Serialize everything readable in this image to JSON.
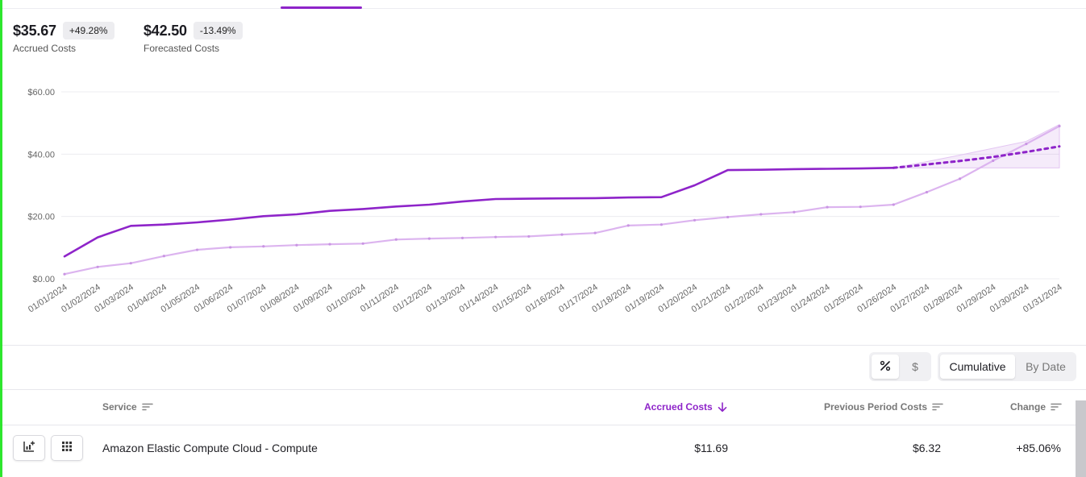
{
  "kpis": [
    {
      "value": "$35.67",
      "change": "+49.28%",
      "label": "Accrued Costs"
    },
    {
      "value": "$42.50",
      "change": "-13.49%",
      "label": "Forecasted Costs"
    }
  ],
  "chart_data": {
    "type": "line",
    "x": [
      "01/01/2024",
      "01/02/2024",
      "01/03/2024",
      "01/04/2024",
      "01/05/2024",
      "01/06/2024",
      "01/07/2024",
      "01/08/2024",
      "01/09/2024",
      "01/10/2024",
      "01/11/2024",
      "01/12/2024",
      "01/13/2024",
      "01/14/2024",
      "01/15/2024",
      "01/16/2024",
      "01/17/2024",
      "01/18/2024",
      "01/19/2024",
      "01/20/2024",
      "01/21/2024",
      "01/22/2024",
      "01/23/2024",
      "01/24/2024",
      "01/25/2024",
      "01/26/2024",
      "01/27/2024",
      "01/28/2024",
      "01/29/2024",
      "01/30/2024",
      "01/31/2024"
    ],
    "yticks": [
      "$0.00",
      "$20.00",
      "$40.00",
      "$60.00"
    ],
    "ylim": [
      0,
      60
    ],
    "grid": true,
    "series": [
      {
        "color": "#8e24c9",
        "values": [
          7.2,
          13.3,
          17.0,
          17.4,
          18.1,
          19.0,
          20.1,
          20.7,
          21.8,
          22.4,
          23.2,
          23.8,
          24.8,
          25.6,
          25.7,
          25.8,
          25.9,
          26.1,
          26.2,
          30.0,
          34.9,
          35.0,
          35.2,
          35.3,
          35.4,
          35.6,
          null,
          null,
          null,
          null,
          null
        ]
      },
      {
        "style": "dashed",
        "color": "#8e24c9",
        "values": [
          null,
          null,
          null,
          null,
          null,
          null,
          null,
          null,
          null,
          null,
          null,
          null,
          null,
          null,
          null,
          null,
          null,
          null,
          null,
          null,
          null,
          null,
          null,
          null,
          null,
          35.6,
          36.7,
          37.8,
          39.1,
          40.7,
          42.5
        ]
      },
      {
        "color": "#dcb4ef",
        "values": [
          1.5,
          3.8,
          5.0,
          7.3,
          9.3,
          10.1,
          10.4,
          10.8,
          11.1,
          11.3,
          12.6,
          12.9,
          13.1,
          13.4,
          13.6,
          14.2,
          14.7,
          17.1,
          17.4,
          18.8,
          19.8,
          20.7,
          21.4,
          23.0,
          23.1,
          23.8,
          27.8,
          32.1,
          37.9,
          43.3,
          49.0
        ]
      }
    ],
    "forecast_band": {
      "start_index": 25,
      "upper": [
        35.6,
        37.6,
        39.7,
        41.9,
        44.1,
        49.5
      ],
      "lower": [
        35.6,
        35.6,
        35.6,
        35.6,
        35.6,
        35.6
      ]
    }
  },
  "toggles": {
    "unit": {
      "percent_icon": "percent-icon",
      "dollar_label": "$"
    },
    "mode": {
      "cumulative": "Cumulative",
      "by_date": "By Date"
    }
  },
  "table": {
    "headers": {
      "service": "Service",
      "accrued": "Accrued Costs",
      "previous": "Previous Period Costs",
      "change": "Change"
    },
    "rows": [
      {
        "service": "Amazon Elastic Compute Cloud - Compute",
        "accrued": "$11.69",
        "previous": "$6.32",
        "change": "+85.06%"
      }
    ]
  },
  "colors": {
    "accent": "#8e24c9",
    "accent_light": "#dcb4ef",
    "rail": "#2ee62e"
  }
}
